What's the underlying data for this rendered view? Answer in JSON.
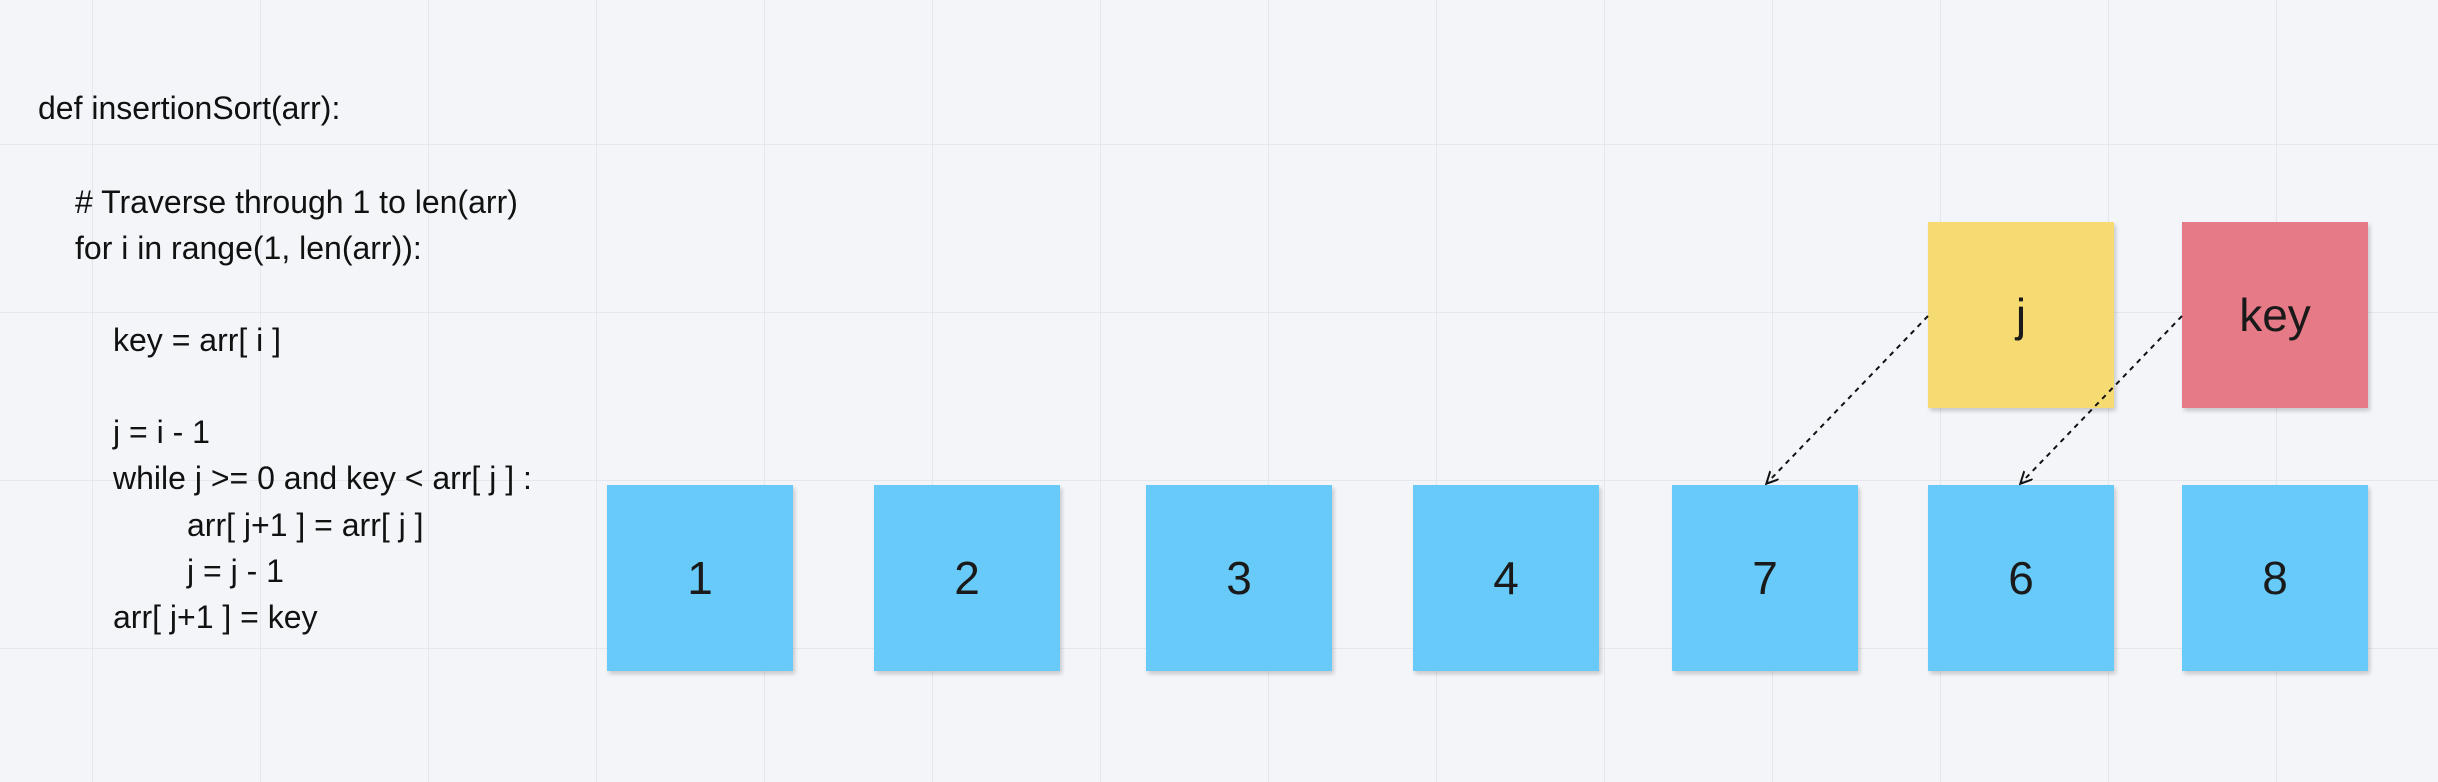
{
  "code": {
    "line1": "def insertionSort(arr):",
    "line2": "# Traverse through 1 to len(arr)",
    "line3": "for i in range(1, len(arr)):",
    "line4": "key = arr[ i ]",
    "line5": "j = i - 1",
    "line6": "while j >= 0 and key < arr[ j ] :",
    "line7": "arr[ j+1 ] = arr[ j ]",
    "line8": "j = j - 1",
    "line9": "arr[ j+1 ] = key"
  },
  "array": [
    "1",
    "2",
    "3",
    "4",
    "7",
    "6",
    "8"
  ],
  "pointers": {
    "j_label": "j",
    "key_label": "key"
  },
  "colors": {
    "array_note": "#67caf9",
    "j_note": "#f6da72",
    "key_note": "#e67a87"
  }
}
